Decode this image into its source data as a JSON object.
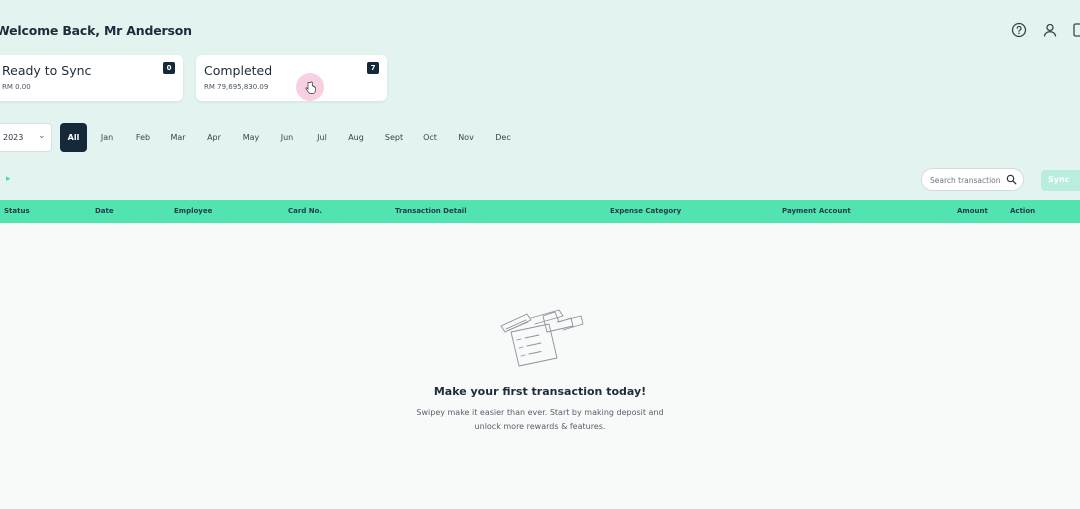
{
  "header": {
    "welcome": "Welcome Back, Mr Anderson",
    "icons": [
      "help-icon",
      "user-icon",
      "logout-icon"
    ]
  },
  "cards": [
    {
      "title": "Ready to Sync",
      "amount": "RM 0.00",
      "count": "0"
    },
    {
      "title": "Completed",
      "amount": "RM 79,695,830.09",
      "count": "7"
    }
  ],
  "filters": {
    "year": "2023",
    "months": [
      "All",
      "Jan",
      "Feb",
      "Mar",
      "Apr",
      "May",
      "Jun",
      "Jul",
      "Aug",
      "Sept",
      "Oct",
      "Nov",
      "Dec"
    ],
    "selected_month": "All"
  },
  "search": {
    "placeholder": "Search transaction",
    "value": ""
  },
  "sync_button": {
    "label": "Sync"
  },
  "table": {
    "columns": [
      "Status",
      "Date",
      "Employee",
      "Card No.",
      "Transaction Detail",
      "Expense Category",
      "Payment Account",
      "Amount",
      "Action"
    ],
    "rows": []
  },
  "empty_state": {
    "title": "Make your first transaction today!",
    "line1": "Swipey make it easier than ever. Start by making deposit and",
    "line2": "unlock more rewards & features."
  },
  "colors": {
    "accent": "#52e4b0",
    "header_bg": "#e3f4f0",
    "dark": "#15293b"
  }
}
